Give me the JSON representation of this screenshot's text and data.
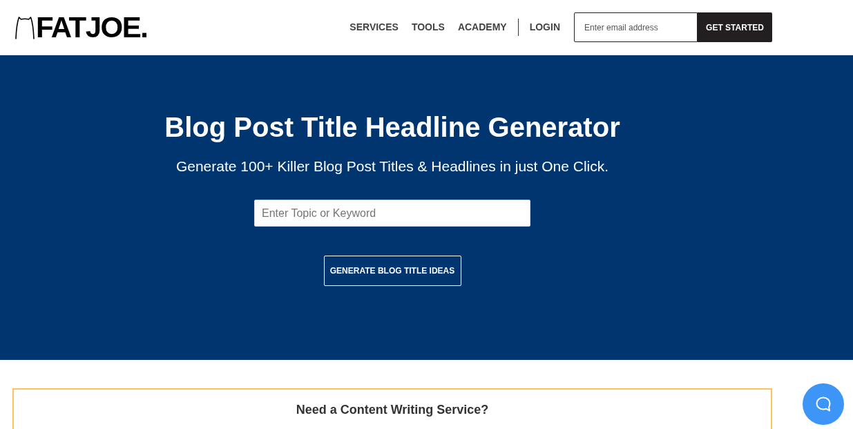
{
  "header": {
    "logo": {
      "text": "FATJOE."
    },
    "nav": [
      {
        "label": "SERVICES"
      },
      {
        "label": "TOOLS"
      },
      {
        "label": "ACADEMY"
      }
    ],
    "login": "LOGIN",
    "signup": {
      "placeholder": "Enter email address",
      "button": "GET STARTED"
    }
  },
  "hero": {
    "title": "Blog Post Title Headline Generator",
    "subtitle": "Generate 100+ Killer Blog Post Titles & Headlines in just One Click.",
    "search": {
      "placeholder": "Enter Topic or Keyword"
    },
    "button": "GENERATE BLOG TITLE IDEAS"
  },
  "promo": {
    "title": "Need a Content Writing Service?"
  }
}
